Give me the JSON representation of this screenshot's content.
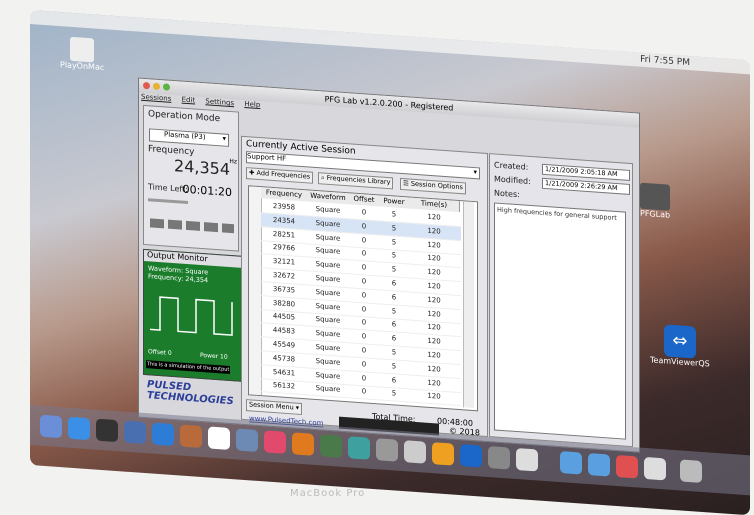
{
  "desktop": {
    "menubar_clock": "Fri 7:55 PM",
    "icons": {
      "top_left": "PlayOnMac",
      "pfglab": "PFGLab",
      "teamviewer": "TeamViewerQS"
    }
  },
  "window": {
    "title": "PFG Lab v1.2.0.200 - Registered",
    "menu": [
      "Sessions",
      "Edit",
      "Settings",
      "Help"
    ]
  },
  "operation": {
    "label": "Operation Mode",
    "mode": "Plasma (P3)",
    "freq_label": "Frequency",
    "freq_value": "24,354",
    "freq_unit": "Hz",
    "time_left_label": "Time Left:",
    "time_left": "00:01:20"
  },
  "monitor": {
    "title": "Output Monitor",
    "waveform": "Waveform: Square",
    "frequency": "Frequency: 24,354",
    "offset": "Offset 0",
    "power": "Power 10",
    "note": "This is a simulation of the output"
  },
  "session": {
    "title": "Currently Active Session",
    "name": "Support HF",
    "add_btn": "Add Frequencies",
    "library_btn": "Frequencies Library",
    "options_btn": "Session Options",
    "headers": [
      "Frequency",
      "Waveform",
      "Offset",
      "Power",
      "Time(s)"
    ],
    "rows": [
      [
        "23958",
        "Square",
        "0",
        "5",
        "120"
      ],
      [
        "24354",
        "Square",
        "0",
        "5",
        "120"
      ],
      [
        "28251",
        "Square",
        "0",
        "5",
        "120"
      ],
      [
        "29766",
        "Square",
        "0",
        "5",
        "120"
      ],
      [
        "32121",
        "Square",
        "0",
        "5",
        "120"
      ],
      [
        "32672",
        "Square",
        "0",
        "6",
        "120"
      ],
      [
        "36735",
        "Square",
        "0",
        "6",
        "120"
      ],
      [
        "38280",
        "Square",
        "0",
        "5",
        "120"
      ],
      [
        "44505",
        "Square",
        "0",
        "6",
        "120"
      ],
      [
        "44583",
        "Square",
        "0",
        "6",
        "120"
      ],
      [
        "45549",
        "Square",
        "0",
        "5",
        "120"
      ],
      [
        "45738",
        "Square",
        "0",
        "5",
        "120"
      ],
      [
        "54631",
        "Square",
        "0",
        "6",
        "120"
      ],
      [
        "56132",
        "Square",
        "0",
        "5",
        "120"
      ]
    ],
    "session_menu": "Session Menu",
    "total_time_label": "Total Time:",
    "total_time": "00:48:00"
  },
  "details": {
    "created_label": "Created:",
    "created": "1/21/2009 2:05:18 AM",
    "modified_label": "Modified:",
    "modified": "1/21/2009 2:26:29 AM",
    "notes_label": "Notes:",
    "notes": "High frequencies for general support"
  },
  "footer": {
    "brand": "PULSED TECHNOLOGIES",
    "website": "www.PulsedTech.com",
    "copyright": "© 2018"
  },
  "laptop_label": "MacBook Pro"
}
